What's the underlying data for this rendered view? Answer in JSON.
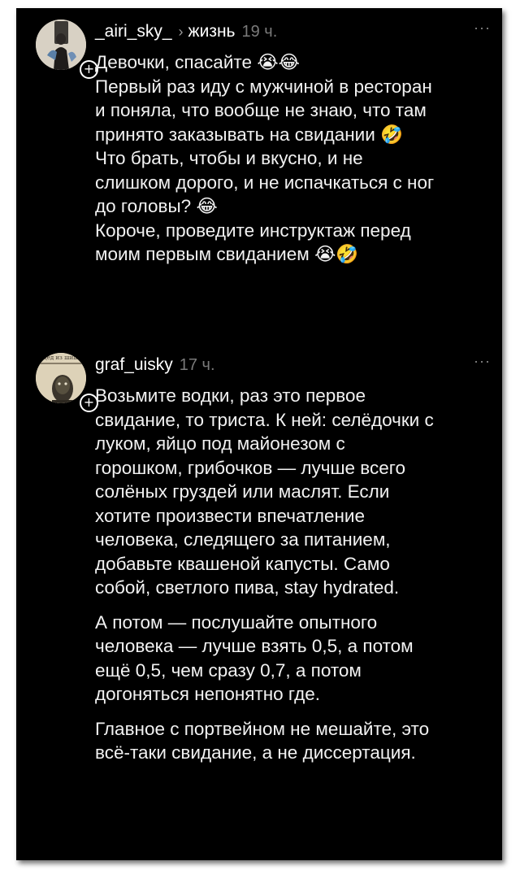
{
  "posts": [
    {
      "username": "_airi_sky_",
      "topic": "жизнь",
      "time": "19 ч.",
      "menu_label": "···",
      "follow_label": "+",
      "paragraphs": [
        "Девочки, спасайте 😭😂\nПервый раз иду с мужчиной в ресторан\nи поняла, что вообще не знаю, что там\nпринято заказывать на свидании 🤣\nЧто брать, чтобы и вкусно, и не\nслишком дорого, и не испачкаться с ног\nдо головы? 😂\nКороче, проведите инструктаж перед\nмоим первым свиданием 😭🤣"
      ]
    },
    {
      "username": "graf_uisky",
      "time": "17 ч.",
      "menu_label": "···",
      "follow_label": "+",
      "avatar_caption": "Дед из шишки",
      "paragraphs": [
        "Возьмите водки, раз это первое\nсвидание, то триста. К ней:  селёдочки с\nлуком, яйцо под майонезом с\nгорошком, грибочков — лучше всего\nсолёных груздей или маслят. Если\nхотите произвести впечатление\nчеловека, следящего за питанием,\nдобавьте квашеной капусты. Само\nсобой, светлого пива, stay hydrated.",
        "А потом — послушайте опытного\nчеловека — лучше взять 0,5, а потом\nещё 0,5, чем сразу 0,7, а потом\nдогоняться непонятно где.",
        "Главное с портвейном не мешайте, это\nвсё-таки свидание, а не диссертация."
      ]
    }
  ],
  "icons": {
    "follow": "plus-icon",
    "menu": "more-icon",
    "breadcrumb": "chevron-right-icon"
  }
}
